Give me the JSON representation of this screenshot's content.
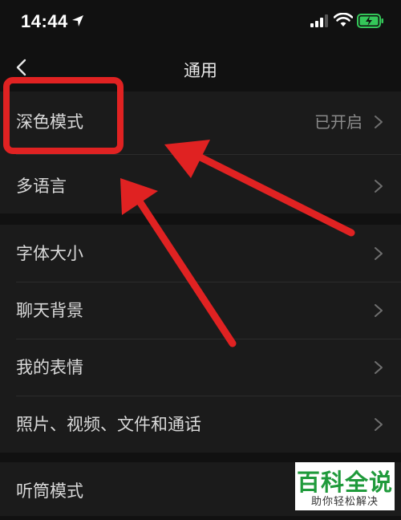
{
  "status_bar": {
    "time": "14:44",
    "icons": [
      "location-arrow-icon",
      "cellular-signal-icon",
      "wifi-icon",
      "battery-charging-icon"
    ],
    "battery_color": "#34c759"
  },
  "nav": {
    "back_icon": "chevron-left-icon",
    "title": "通用"
  },
  "groups": [
    {
      "items": [
        {
          "label": "深色模式",
          "value": "已开启"
        },
        {
          "label": "多语言",
          "value": ""
        }
      ]
    },
    {
      "items": [
        {
          "label": "字体大小"
        },
        {
          "label": "聊天背景"
        },
        {
          "label": "我的表情"
        },
        {
          "label": "照片、视频、文件和通话"
        }
      ]
    },
    {
      "items": [
        {
          "label": "听筒模式"
        }
      ]
    }
  ],
  "annotations": {
    "highlight_color": "#e02222",
    "arrow_color": "#e02222"
  },
  "watermark": {
    "title": "百科全说",
    "subtitle": "助你轻松解决",
    "title_color": "#1f9a3b"
  }
}
